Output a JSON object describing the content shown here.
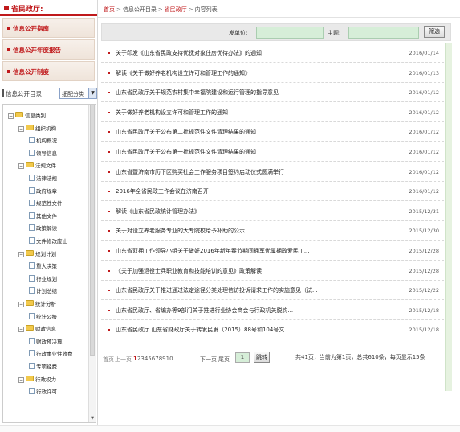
{
  "sidebar": {
    "title": "省民政厅:",
    "guide_items": [
      "信息公开指南",
      "信息公开年度报告",
      "信息公开制度"
    ],
    "directory_label": "信息公开目录",
    "category_select": "细配分类",
    "tree": [
      {
        "label": "信息类别",
        "depth": 0,
        "kind": "folder"
      },
      {
        "label": "组织机构",
        "depth": 1,
        "kind": "folder"
      },
      {
        "label": "机构概况",
        "depth": 2,
        "kind": "doc"
      },
      {
        "label": "领导信息",
        "depth": 2,
        "kind": "doc"
      },
      {
        "label": "法规文件",
        "depth": 1,
        "kind": "folder"
      },
      {
        "label": "法律法规",
        "depth": 2,
        "kind": "doc"
      },
      {
        "label": "政府规章",
        "depth": 2,
        "kind": "doc"
      },
      {
        "label": "规范性文件",
        "depth": 2,
        "kind": "doc"
      },
      {
        "label": "其他文件",
        "depth": 2,
        "kind": "doc"
      },
      {
        "label": "政策解读",
        "depth": 2,
        "kind": "doc"
      },
      {
        "label": "文件修改废止",
        "depth": 2,
        "kind": "doc"
      },
      {
        "label": "规划计划",
        "depth": 1,
        "kind": "folder"
      },
      {
        "label": "重大决策",
        "depth": 2,
        "kind": "doc"
      },
      {
        "label": "行业规划",
        "depth": 2,
        "kind": "doc"
      },
      {
        "label": "计划总结",
        "depth": 2,
        "kind": "doc"
      },
      {
        "label": "统计分析",
        "depth": 1,
        "kind": "folder"
      },
      {
        "label": "统计公报",
        "depth": 2,
        "kind": "doc"
      },
      {
        "label": "财政信息",
        "depth": 1,
        "kind": "folder"
      },
      {
        "label": "财政预决算",
        "depth": 2,
        "kind": "doc"
      },
      {
        "label": "行政事业性收费",
        "depth": 2,
        "kind": "doc"
      },
      {
        "label": "专项经费",
        "depth": 2,
        "kind": "doc"
      },
      {
        "label": "行政权力",
        "depth": 1,
        "kind": "folder"
      },
      {
        "label": "行政许可",
        "depth": 2,
        "kind": "doc"
      }
    ]
  },
  "breadcrumb": {
    "home": "首页",
    "sep": ">",
    "items": [
      "信息公开目录",
      "省民政厅",
      "内容列表"
    ]
  },
  "filter": {
    "issuer_label": "发单位:",
    "keyword_label": "主题:",
    "submit_label": "筛选"
  },
  "list": [
    {
      "title": "关于印发《山东省民政支持优抚对象住房优待办法》的通知",
      "date": "2016/01/14"
    },
    {
      "title": "解读《关于做好养老机构设立许可和管理工作的通知》",
      "date": "2016/01/13"
    },
    {
      "title": "山东省民政厅关于规范农村集中幸福院建设和运行管理的指导意见",
      "date": "2016/01/12"
    },
    {
      "title": "关于做好养老机构设立许可和管理工作的通知",
      "date": "2016/01/12"
    },
    {
      "title": "山东省民政厅关于公布第二批规范性文件清理结果的通知",
      "date": "2016/01/12"
    },
    {
      "title": "山东省民政厅关于公布第一批规范性文件清理结果的通知",
      "date": "2016/01/12"
    },
    {
      "title": "山东省暨济南市历下区购买社会工作服务项目签约启动仪式圆满举行",
      "date": "2016/01/12"
    },
    {
      "title": "2016年全省民政工作会议在济南召开",
      "date": "2016/01/12"
    },
    {
      "title": "解读《山东省民政统计管理办法》",
      "date": "2015/12/31"
    },
    {
      "title": "关于对设立养老服务专业的大专院校给予补助的公示",
      "date": "2015/12/30"
    },
    {
      "title": "山东省双拥工作领导小组关于做好2016年新年春节期间拥军优属拥政爱民工...",
      "date": "2015/12/28"
    },
    {
      "title": "《关于加强退役士兵职业教育和技能培训的意见》政策解读",
      "date": "2015/12/28"
    },
    {
      "title": "山东省民政厅关于推进通过法定途径分类处理信访投诉请求工作的实施意见（试...",
      "date": "2015/12/22"
    },
    {
      "title": "山东省民政厅、省编办等9部门关于推进行业协会商会与行政机关脱钩...",
      "date": "2015/12/18"
    },
    {
      "title": "山东省民政厅 山东省财政厅关于转发民发（2015）88号和104号文...",
      "date": "2015/12/18"
    }
  ],
  "pager": {
    "first": "首页",
    "prev": "上一页",
    "pages": [
      "1",
      "2",
      "3",
      "4",
      "5",
      "6",
      "7",
      "8",
      "9",
      "10",
      "..."
    ],
    "current": "1",
    "next": "下一页",
    "last": "尾页",
    "jump_value": "1",
    "jump_button": "跳转",
    "summary": "共41页，当前为第1页，总共610条，每页显示15条"
  },
  "colors": {
    "accent_red": "#c0191b",
    "input_green": "#d6eed8"
  }
}
